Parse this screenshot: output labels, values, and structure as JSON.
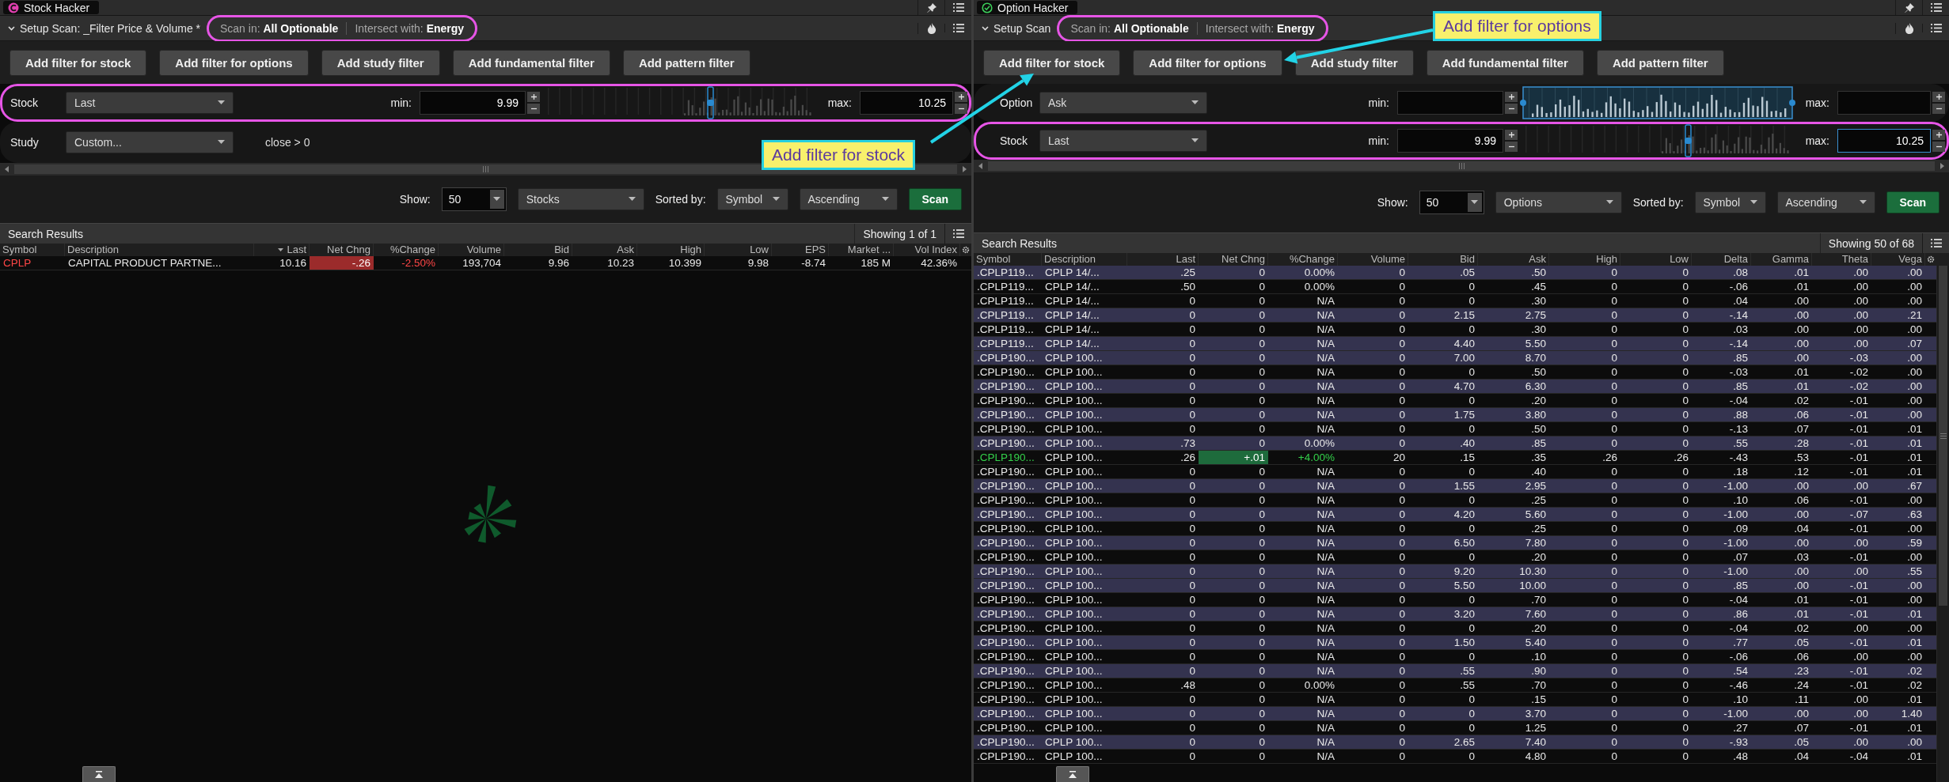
{
  "panels": [
    {
      "kind": "stock",
      "title": "Stock Hacker",
      "setup_title": "Setup Scan: _Filter Price & Volume *",
      "scope_annotated": true,
      "scan_in": "Scan in: **All Optionable**",
      "intersect": "Intersect with: **Energy**",
      "filter_buttons": [
        "Add filter for stock",
        "Add filter for options",
        "Add study filter",
        "Add fundamental filter",
        "Add pattern filter"
      ],
      "filters": [
        {
          "kind": "range",
          "category": "Stock",
          "field": "Last",
          "min_label": "min:",
          "min": "9.99",
          "max_label": "max:",
          "max": "10.25",
          "annotated": true,
          "histogram_selected": false,
          "max_focused": false
        },
        {
          "kind": "study",
          "category": "Study",
          "field": "Custom...",
          "formula": "close > 0",
          "annotated": false
        }
      ],
      "show_label": "Show:",
      "show_count": "50",
      "result_type": "Stocks",
      "sort_label": "Sorted by:",
      "sort_field": "Symbol",
      "sort_order": "Ascending",
      "scan_button": "Scan",
      "results_title": "Search Results",
      "results_count": "Showing 1 of 1",
      "loading": true,
      "columns": [
        {
          "label": "Symbol",
          "kind": "symbol",
          "sorted": false
        },
        {
          "label": "Description",
          "kind": "text",
          "sorted": false
        },
        {
          "label": "Last",
          "kind": "number",
          "sorted": true
        },
        {
          "label": "Net Chng",
          "kind": "net_change",
          "sorted": false
        },
        {
          "label": "%Change",
          "kind": "pct_change",
          "sorted": false
        },
        {
          "label": "Volume",
          "kind": "number",
          "sorted": false
        },
        {
          "label": "Bid",
          "kind": "number",
          "sorted": false
        },
        {
          "label": "Ask",
          "kind": "number",
          "sorted": false
        },
        {
          "label": "High",
          "kind": "number",
          "sorted": false
        },
        {
          "label": "Low",
          "kind": "number",
          "sorted": false
        },
        {
          "label": "EPS",
          "kind": "number",
          "sorted": false
        },
        {
          "label": "Market ...",
          "kind": "number",
          "sorted": false
        },
        {
          "label": "Vol Index",
          "kind": "number",
          "sorted": false
        }
      ],
      "rows": [
        {
          "gain": false,
          "loss": true,
          "highlighted": false,
          "cells": [
            "CPLP",
            "CAPITAL PRODUCT PARTNE...",
            "10.16",
            "-.26",
            "-2.50%",
            "193,704",
            "9.96",
            "10.23",
            "10.399",
            "9.98",
            "-8.74",
            "185 M",
            "42.36%"
          ]
        }
      ]
    },
    {
      "kind": "option",
      "title": "Option Hacker",
      "setup_title": "Setup Scan",
      "scope_annotated": true,
      "scan_in": "Scan in: **All Optionable**",
      "intersect": "Intersect with: **Energy**",
      "filter_buttons": [
        "Add filter for stock",
        "Add filter for options",
        "Add study filter",
        "Add fundamental filter",
        "Add pattern filter"
      ],
      "filters": [
        {
          "kind": "range",
          "category": "Option",
          "field": "Ask",
          "min_label": "min:",
          "max_label": "max:",
          "annotated": false,
          "histogram_selected": true,
          "max_focused": false
        },
        {
          "kind": "range",
          "category": "Stock",
          "field": "Last",
          "min_label": "min:",
          "min": "9.99",
          "max_label": "max:",
          "max": "10.25",
          "annotated": true,
          "histogram_selected": false,
          "max_focused": true
        }
      ],
      "show_label": "Show:",
      "show_count": "50",
      "result_type": "Options",
      "sort_label": "Sorted by:",
      "sort_field": "Symbol",
      "sort_order": "Ascending",
      "scan_button": "Scan",
      "results_title": "Search Results",
      "results_count": "Showing 50 of 68",
      "columns": [
        {
          "label": "Symbol",
          "kind": "symbol",
          "sorted": false
        },
        {
          "label": "Description",
          "kind": "text",
          "sorted": false
        },
        {
          "label": "Last",
          "kind": "number",
          "sorted": false
        },
        {
          "label": "Net Chng",
          "kind": "net_change",
          "sorted": false
        },
        {
          "label": "%Change",
          "kind": "pct_change",
          "sorted": false
        },
        {
          "label": "Volume",
          "kind": "number",
          "sorted": false
        },
        {
          "label": "Bid",
          "kind": "number",
          "sorted": false
        },
        {
          "label": "Ask",
          "kind": "number",
          "sorted": false
        },
        {
          "label": "High",
          "kind": "number",
          "sorted": false
        },
        {
          "label": "Low",
          "kind": "number",
          "sorted": false
        },
        {
          "label": "Delta",
          "kind": "number",
          "sorted": false
        },
        {
          "label": "Gamma",
          "kind": "number",
          "sorted": false
        },
        {
          "label": "Theta",
          "kind": "number",
          "sorted": false
        },
        {
          "label": "Vega",
          "kind": "number",
          "sorted": false
        }
      ],
      "rows": [
        {
          "gain": false,
          "loss": false,
          "highlighted": true,
          "cells": [
            ".CPLP119...",
            "CPLP 14/...",
            ".25",
            "0",
            "0.00%",
            "0",
            ".05",
            ".50",
            "0",
            "0",
            ".08",
            ".01",
            ".00",
            ".00"
          ]
        },
        {
          "gain": false,
          "loss": false,
          "highlighted": false,
          "cells": [
            ".CPLP119...",
            "CPLP 14/...",
            ".50",
            "0",
            "0.00%",
            "0",
            "0",
            ".45",
            "0",
            "0",
            "-.06",
            ".01",
            ".00",
            ".00"
          ]
        },
        {
          "gain": false,
          "loss": false,
          "highlighted": false,
          "cells": [
            ".CPLP119...",
            "CPLP 14/...",
            "0",
            "0",
            "N/A",
            "0",
            "0",
            ".30",
            "0",
            "0",
            ".04",
            ".00",
            ".00",
            ".00"
          ]
        },
        {
          "gain": false,
          "loss": false,
          "highlighted": true,
          "cells": [
            ".CPLP119...",
            "CPLP 14/...",
            "0",
            "0",
            "N/A",
            "0",
            "2.15",
            "2.75",
            "0",
            "0",
            "-.14",
            ".00",
            ".00",
            ".21"
          ]
        },
        {
          "gain": false,
          "loss": false,
          "highlighted": false,
          "cells": [
            ".CPLP119...",
            "CPLP 14/...",
            "0",
            "0",
            "N/A",
            "0",
            "0",
            ".30",
            "0",
            "0",
            ".03",
            ".00",
            ".00",
            ".00"
          ]
        },
        {
          "gain": false,
          "loss": false,
          "highlighted": true,
          "cells": [
            ".CPLP119...",
            "CPLP 14/...",
            "0",
            "0",
            "N/A",
            "0",
            "4.40",
            "5.50",
            "0",
            "0",
            "-.14",
            ".00",
            ".00",
            ".07"
          ]
        },
        {
          "gain": false,
          "loss": false,
          "highlighted": true,
          "cells": [
            ".CPLP190...",
            "CPLP 100...",
            "0",
            "0",
            "N/A",
            "0",
            "7.00",
            "8.70",
            "0",
            "0",
            ".85",
            ".00",
            "-.03",
            ".00"
          ]
        },
        {
          "gain": false,
          "loss": false,
          "highlighted": false,
          "cells": [
            ".CPLP190...",
            "CPLP 100...",
            "0",
            "0",
            "N/A",
            "0",
            "0",
            ".50",
            "0",
            "0",
            "-.03",
            ".01",
            "-.02",
            ".00"
          ]
        },
        {
          "gain": false,
          "loss": false,
          "highlighted": true,
          "cells": [
            ".CPLP190...",
            "CPLP 100...",
            "0",
            "0",
            "N/A",
            "0",
            "4.70",
            "6.30",
            "0",
            "0",
            ".85",
            ".01",
            "-.02",
            ".00"
          ]
        },
        {
          "gain": false,
          "loss": false,
          "highlighted": false,
          "cells": [
            ".CPLP190...",
            "CPLP 100...",
            "0",
            "0",
            "N/A",
            "0",
            "0",
            ".20",
            "0",
            "0",
            "-.04",
            ".02",
            "-.01",
            ".00"
          ]
        },
        {
          "gain": false,
          "loss": false,
          "highlighted": true,
          "cells": [
            ".CPLP190...",
            "CPLP 100...",
            "0",
            "0",
            "N/A",
            "0",
            "1.75",
            "3.80",
            "0",
            "0",
            ".88",
            ".06",
            "-.01",
            ".00"
          ]
        },
        {
          "gain": false,
          "loss": false,
          "highlighted": false,
          "cells": [
            ".CPLP190...",
            "CPLP 100...",
            "0",
            "0",
            "N/A",
            "0",
            "0",
            ".50",
            "0",
            "0",
            "-.13",
            ".07",
            "-.01",
            ".01"
          ]
        },
        {
          "gain": false,
          "loss": false,
          "highlighted": true,
          "cells": [
            ".CPLP190...",
            "CPLP 100...",
            ".73",
            "0",
            "0.00%",
            "0",
            ".40",
            ".85",
            "0",
            "0",
            ".55",
            ".28",
            "-.01",
            ".01"
          ]
        },
        {
          "gain": true,
          "loss": false,
          "highlighted": false,
          "cells": [
            ".CPLP190...",
            "CPLP 100...",
            ".26",
            "+.01",
            "+4.00%",
            "20",
            ".15",
            ".35",
            ".26",
            ".26",
            "-.43",
            ".53",
            "-.01",
            ".01"
          ]
        },
        {
          "gain": false,
          "loss": false,
          "highlighted": false,
          "cells": [
            ".CPLP190...",
            "CPLP 100...",
            "0",
            "0",
            "N/A",
            "0",
            "0",
            ".40",
            "0",
            "0",
            ".18",
            ".12",
            "-.01",
            ".01"
          ]
        },
        {
          "gain": false,
          "loss": false,
          "highlighted": true,
          "cells": [
            ".CPLP190...",
            "CPLP 100...",
            "0",
            "0",
            "N/A",
            "0",
            "1.55",
            "2.95",
            "0",
            "0",
            "-1.00",
            ".00",
            ".00",
            ".67"
          ]
        },
        {
          "gain": false,
          "loss": false,
          "highlighted": false,
          "cells": [
            ".CPLP190...",
            "CPLP 100...",
            "0",
            "0",
            "N/A",
            "0",
            "0",
            ".25",
            "0",
            "0",
            ".10",
            ".06",
            "-.01",
            ".00"
          ]
        },
        {
          "gain": false,
          "loss": false,
          "highlighted": true,
          "cells": [
            ".CPLP190...",
            "CPLP 100...",
            "0",
            "0",
            "N/A",
            "0",
            "4.20",
            "5.60",
            "0",
            "0",
            "-1.00",
            ".00",
            "-.07",
            ".63"
          ]
        },
        {
          "gain": false,
          "loss": false,
          "highlighted": false,
          "cells": [
            ".CPLP190...",
            "CPLP 100...",
            "0",
            "0",
            "N/A",
            "0",
            "0",
            ".25",
            "0",
            "0",
            ".09",
            ".04",
            "-.01",
            ".00"
          ]
        },
        {
          "gain": false,
          "loss": false,
          "highlighted": true,
          "cells": [
            ".CPLP190...",
            "CPLP 100...",
            "0",
            "0",
            "N/A",
            "0",
            "6.50",
            "7.80",
            "0",
            "0",
            "-1.00",
            ".00",
            ".00",
            ".59"
          ]
        },
        {
          "gain": false,
          "loss": false,
          "highlighted": false,
          "cells": [
            ".CPLP190...",
            "CPLP 100...",
            "0",
            "0",
            "N/A",
            "0",
            "0",
            ".20",
            "0",
            "0",
            ".07",
            ".03",
            "-.01",
            ".00"
          ]
        },
        {
          "gain": false,
          "loss": false,
          "highlighted": true,
          "cells": [
            ".CPLP190...",
            "CPLP 100...",
            "0",
            "0",
            "N/A",
            "0",
            "9.20",
            "10.30",
            "0",
            "0",
            "-1.00",
            ".00",
            ".00",
            ".55"
          ]
        },
        {
          "gain": false,
          "loss": false,
          "highlighted": true,
          "cells": [
            ".CPLP190...",
            "CPLP 100...",
            "0",
            "0",
            "N/A",
            "0",
            "5.50",
            "10.00",
            "0",
            "0",
            ".85",
            ".00",
            "-.01",
            ".00"
          ]
        },
        {
          "gain": false,
          "loss": false,
          "highlighted": false,
          "cells": [
            ".CPLP190...",
            "CPLP 100...",
            "0",
            "0",
            "N/A",
            "0",
            "0",
            ".70",
            "0",
            "0",
            "-.04",
            ".01",
            "-.01",
            ".00"
          ]
        },
        {
          "gain": false,
          "loss": false,
          "highlighted": true,
          "cells": [
            ".CPLP190...",
            "CPLP 100...",
            "0",
            "0",
            "N/A",
            "0",
            "3.20",
            "7.60",
            "0",
            "0",
            ".86",
            ".01",
            "-.01",
            ".01"
          ]
        },
        {
          "gain": false,
          "loss": false,
          "highlighted": false,
          "cells": [
            ".CPLP190...",
            "CPLP 100...",
            "0",
            "0",
            "N/A",
            "0",
            "0",
            ".20",
            "0",
            "0",
            "-.04",
            ".02",
            ".00",
            ".00"
          ]
        },
        {
          "gain": false,
          "loss": false,
          "highlighted": true,
          "cells": [
            ".CPLP190...",
            "CPLP 100...",
            "0",
            "0",
            "N/A",
            "0",
            "1.50",
            "5.40",
            "0",
            "0",
            ".77",
            ".05",
            "-.01",
            ".01"
          ]
        },
        {
          "gain": false,
          "loss": false,
          "highlighted": false,
          "cells": [
            ".CPLP190...",
            "CPLP 100...",
            "0",
            "0",
            "N/A",
            "0",
            "0",
            ".10",
            "0",
            "0",
            "-.06",
            ".06",
            ".00",
            ".00"
          ]
        },
        {
          "gain": false,
          "loss": false,
          "highlighted": true,
          "cells": [
            ".CPLP190...",
            "CPLP 100...",
            "0",
            "0",
            "N/A",
            "0",
            ".55",
            ".90",
            "0",
            "0",
            ".54",
            ".23",
            "-.01",
            ".02"
          ]
        },
        {
          "gain": false,
          "loss": false,
          "highlighted": false,
          "cells": [
            ".CPLP190...",
            "CPLP 100...",
            ".48",
            "0",
            "0.00%",
            "0",
            ".55",
            ".70",
            "0",
            "0",
            "-.46",
            ".24",
            "-.01",
            ".02"
          ]
        },
        {
          "gain": false,
          "loss": false,
          "highlighted": false,
          "cells": [
            ".CPLP190...",
            "CPLP 100...",
            "0",
            "0",
            "N/A",
            "0",
            "0",
            ".15",
            "0",
            "0",
            ".10",
            ".11",
            ".00",
            ".01"
          ]
        },
        {
          "gain": false,
          "loss": false,
          "highlighted": true,
          "cells": [
            ".CPLP190...",
            "CPLP 100...",
            "0",
            "0",
            "N/A",
            "0",
            "0",
            "3.70",
            "0",
            "0",
            "-1.00",
            ".00",
            ".00",
            "1.40"
          ]
        },
        {
          "gain": false,
          "loss": false,
          "highlighted": false,
          "cells": [
            ".CPLP190...",
            "CPLP 100...",
            "0",
            "0",
            "N/A",
            "0",
            "0",
            "1.25",
            "0",
            "0",
            ".27",
            ".07",
            "-.01",
            ".01"
          ]
        },
        {
          "gain": false,
          "loss": false,
          "highlighted": true,
          "cells": [
            ".CPLP190...",
            "CPLP 100...",
            "0",
            "0",
            "N/A",
            "0",
            "2.65",
            "7.40",
            "0",
            "0",
            "-.93",
            ".05",
            ".00",
            ".00"
          ]
        },
        {
          "gain": false,
          "loss": false,
          "highlighted": false,
          "cells": [
            ".CPLP190...",
            "CPLP 100...",
            "0",
            "0",
            "N/A",
            "0",
            "0",
            "4.80",
            "0",
            "0",
            ".48",
            ".04",
            "-.04",
            ".01"
          ]
        }
      ]
    }
  ],
  "callouts": [
    {
      "text": "Add filter for stock"
    },
    {
      "text": "Add filter for options"
    }
  ]
}
